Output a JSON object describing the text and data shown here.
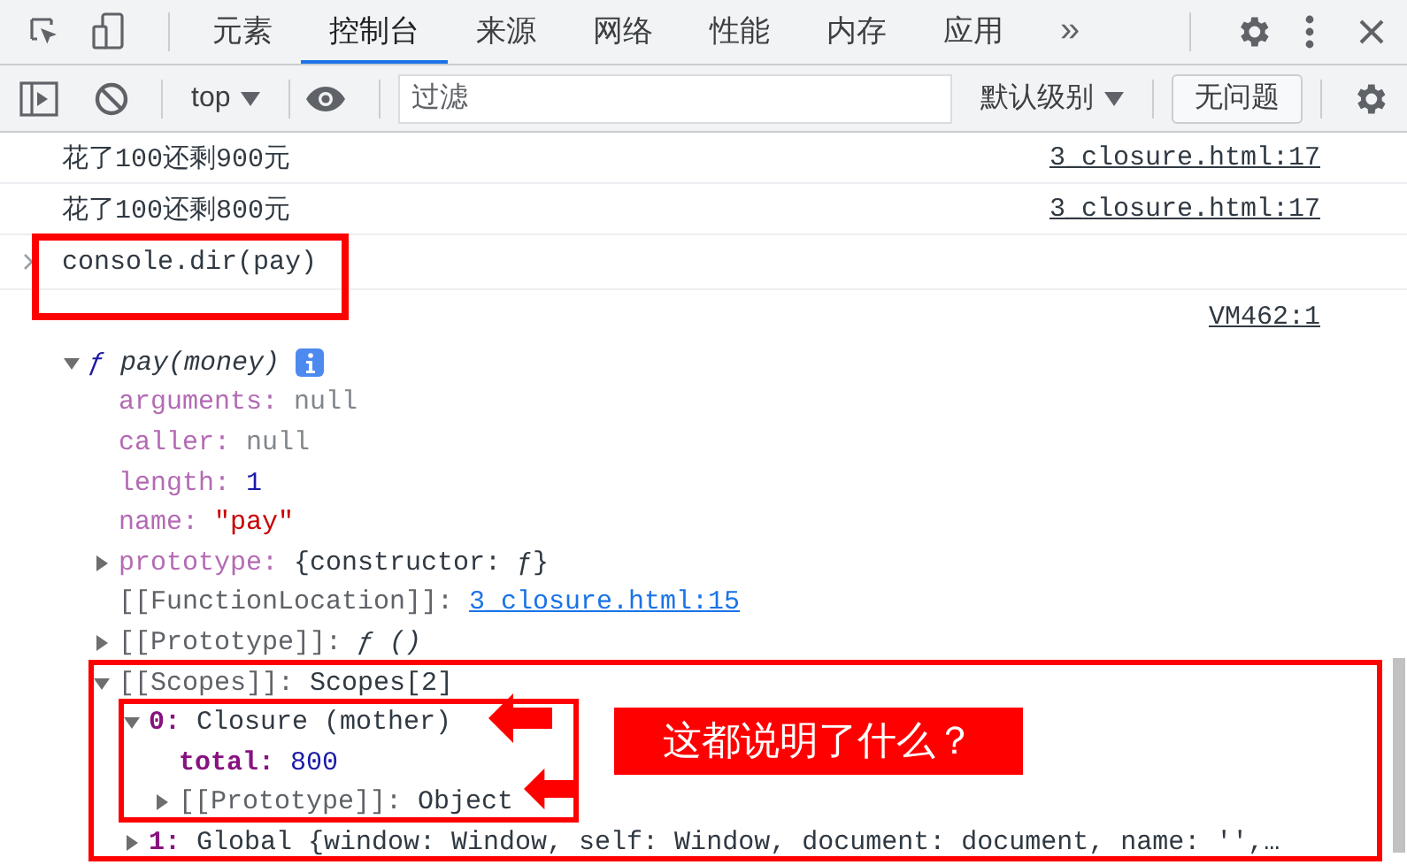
{
  "toolbar": {
    "tabs": [
      {
        "label": "元素",
        "selected": false
      },
      {
        "label": "控制台",
        "selected": true
      },
      {
        "label": "来源",
        "selected": false
      },
      {
        "label": "网络",
        "selected": false
      },
      {
        "label": "性能",
        "selected": false
      },
      {
        "label": "内存",
        "selected": false
      },
      {
        "label": "应用",
        "selected": false
      }
    ],
    "more": "»"
  },
  "console_toolbar": {
    "context": "top",
    "filter_placeholder": "过滤",
    "level": "默认级别",
    "issues": "无问题"
  },
  "messages": [
    {
      "kind": "log",
      "text": "花了100还剩900元",
      "source": "3_closure.html:17"
    },
    {
      "kind": "log",
      "text": "花了100还剩800元",
      "source": "3_closure.html:17"
    },
    {
      "kind": "input",
      "text": "console.dir(pay)"
    },
    {
      "kind": "source",
      "source": "VM462:1"
    }
  ],
  "tree": {
    "sign": "ƒ",
    "signature": "pay(money)",
    "expanded": true,
    "children": [
      {
        "key": {
          "text": "arguments:",
          "kind": "hidden"
        },
        "value": {
          "text": "null",
          "kind": "null"
        },
        "expandable": false
      },
      {
        "key": {
          "text": "caller:",
          "kind": "hidden"
        },
        "value": {
          "text": "null",
          "kind": "null"
        },
        "expandable": false
      },
      {
        "key": {
          "text": "length:",
          "kind": "hidden"
        },
        "value": {
          "text": "1",
          "kind": "number"
        },
        "expandable": false
      },
      {
        "key": {
          "text": "name:",
          "kind": "hidden"
        },
        "value": {
          "text": "\"pay\"",
          "kind": "string"
        },
        "expandable": false
      },
      {
        "key": {
          "text": "prototype:",
          "kind": "hidden"
        },
        "value": {
          "text": "{constructor: ƒ}",
          "kind": "plain"
        },
        "expandable": true,
        "expanded": false
      },
      {
        "key": {
          "text": "[[FunctionLocation]]:",
          "kind": "internal"
        },
        "value": {
          "text": "3_closure.html:15",
          "kind": "link"
        },
        "expandable": false
      },
      {
        "key": {
          "text": "[[Prototype]]:",
          "kind": "internal"
        },
        "value": {
          "text": "ƒ ()",
          "kind": "func"
        },
        "expandable": true,
        "expanded": false
      },
      {
        "key": {
          "text": "[[Scopes]]:",
          "kind": "internal"
        },
        "value": {
          "text": "Scopes[2]",
          "kind": "plain"
        },
        "expandable": true,
        "expanded": true,
        "children": [
          {
            "key": {
              "text": "0:",
              "kind": "own"
            },
            "value": {
              "text": "Closure (mother)",
              "kind": "plain"
            },
            "expandable": true,
            "expanded": true,
            "children": [
              {
                "key": {
                  "text": "total:",
                  "kind": "own"
                },
                "value": {
                  "text": "800",
                  "kind": "number"
                },
                "expandable": false
              },
              {
                "key": {
                  "text": "[[Prototype]]:",
                  "kind": "internal"
                },
                "value": {
                  "text": "Object",
                  "kind": "plain"
                },
                "expandable": true,
                "expanded": false
              }
            ]
          },
          {
            "key": {
              "text": "1:",
              "kind": "own"
            },
            "value": {
              "text": "Global {window: Window, self: Window, document: document, name: '',…",
              "kind": "plain"
            },
            "expandable": true,
            "expanded": false
          }
        ]
      }
    ]
  },
  "annotation": {
    "text": "这都说明了什么？"
  }
}
